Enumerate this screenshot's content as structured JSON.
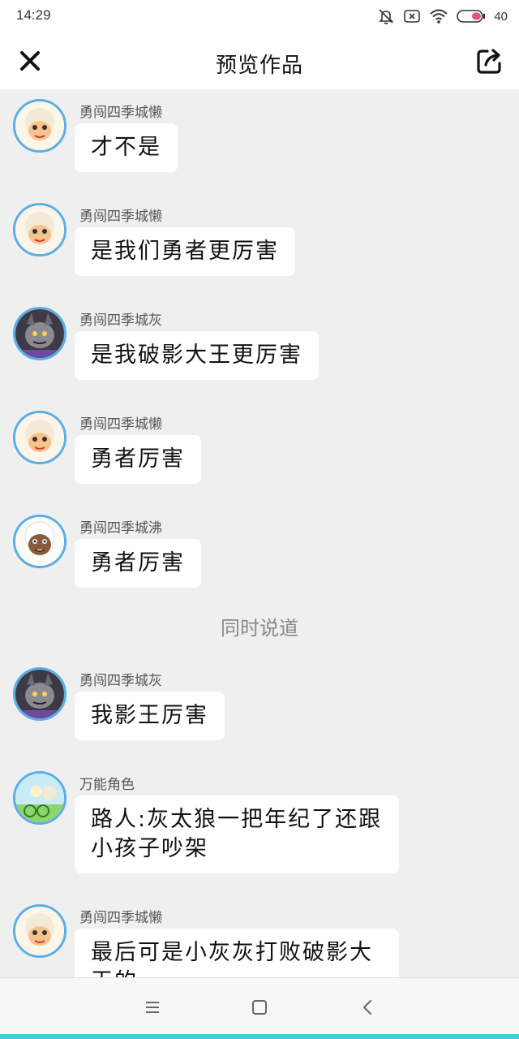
{
  "status_bar": {
    "time": "14:29",
    "battery": "40",
    "icons": [
      "bell-muted-icon",
      "notification-x-icon",
      "wifi-icon",
      "battery-icon"
    ]
  },
  "header": {
    "title": "预览作品",
    "close_icon": "close-icon",
    "share_icon": "share-icon"
  },
  "messages": [
    {
      "name": "勇闯四季城懒",
      "text": "才不是",
      "avatar": "lazy-sheep-avatar"
    },
    {
      "name": "勇闯四季城懒",
      "text": "是我们勇者更厉害",
      "avatar": "lazy-sheep-avatar"
    },
    {
      "name": "勇闯四季城灰",
      "text": "是我破影大王更厉害",
      "avatar": "grey-wolf-avatar"
    },
    {
      "name": "勇闯四季城懒",
      "text": "勇者厉害",
      "avatar": "lazy-sheep-avatar"
    },
    {
      "name": "勇闯四季城沸",
      "text": "勇者厉害",
      "avatar": "fit-sheep-avatar"
    },
    {
      "name": "勇闯四季城灰",
      "text": "我影王厉害",
      "avatar": "grey-wolf-avatar"
    },
    {
      "name": "万能角色",
      "text": "路人:灰太狼一把年纪了还跟小孩子吵架",
      "avatar": "universal-role-avatar"
    },
    {
      "name": "勇闯四季城懒",
      "text": "最后可是小灰灰打败破影大王的",
      "avatar": "lazy-sheep-avatar"
    }
  ],
  "divider": "同时说道",
  "nav_bar": {
    "items": [
      "menu-icon",
      "home-icon",
      "back-icon"
    ]
  },
  "colors": {
    "avatar_border": "#5aaee8",
    "background": "#efefef",
    "accent": "#3cd3d8"
  }
}
